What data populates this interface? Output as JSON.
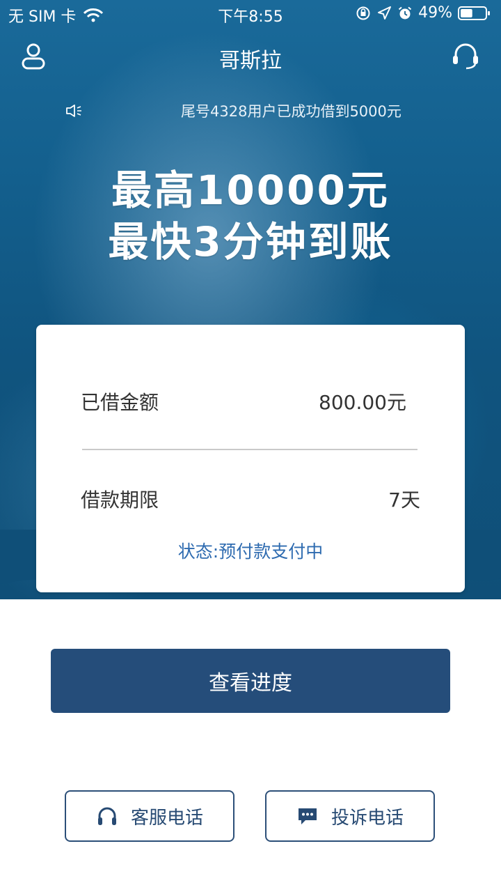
{
  "status_bar": {
    "carrier": "无 SIM 卡",
    "time": "下午8:55",
    "battery": "49%",
    "battery_level": 0.49
  },
  "nav": {
    "title": "哥斯拉",
    "left_icon": "user-icon",
    "right_icon": "headset-icon"
  },
  "notice": {
    "icon": "speaker-icon",
    "text": "尾号4328用户已成功借到5000元"
  },
  "headline": {
    "line1": "最高10000元",
    "line2": "最快3分钟到账"
  },
  "loan_card": {
    "amount_label": "已借金额",
    "amount_value": "800.00元",
    "term_label": "借款期限",
    "term_value": "7天",
    "status": "状态:预付款支付中"
  },
  "actions": {
    "progress_button": "查看进度",
    "service_button": "客服电话",
    "complaint_button": "投诉电话"
  },
  "colors": {
    "primary": "#254d7a",
    "hero": "#135f8d",
    "status_text": "#2e6bb0"
  }
}
